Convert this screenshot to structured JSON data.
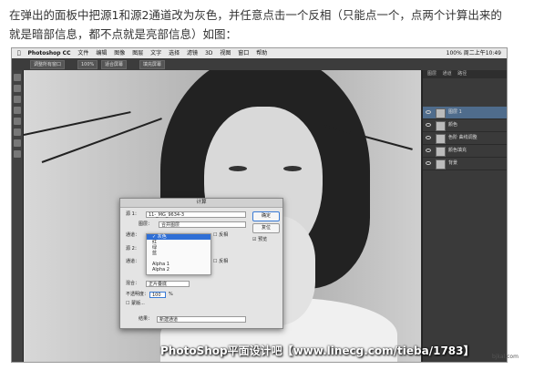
{
  "caption": "在弹出的面板中把源1和源2通道改为灰色，并任意点击一个反相（只能点一个，点两个计算出来的就是暗部信息，都不点就是亮部信息）如图：",
  "menubar": {
    "app": "Photoshop CC",
    "items": [
      "文件",
      "编辑",
      "图像",
      "图层",
      "文字",
      "选择",
      "滤镜",
      "3D",
      "视图",
      "窗口",
      "帮助"
    ],
    "status": "100% 周二上午10:49"
  },
  "options": {
    "chip1": "调整所有窗口",
    "chip2": "100%",
    "chip3": "适合屏幕",
    "chip4": "填充屏幕"
  },
  "dialog": {
    "title": "计算",
    "source1_label": "源 1：",
    "source1_value": "11-_MG_9634-3",
    "layer_label": "图层：",
    "layer_value": "合并图层",
    "channel_label": "通道：",
    "invert_label": "反相",
    "source2_label": "源 2：",
    "blend_label": "混合：",
    "blend_value": "正片叠底",
    "opacity_label": "不透明度：",
    "opacity_value": "100",
    "opacity_unit": "%",
    "mask_label": "蒙版...",
    "result_label": "结果：",
    "result_value": "新建通道",
    "ok": "确定",
    "reset": "复位",
    "preview": "预览",
    "dropdown": [
      "灰色",
      "红",
      "绿",
      "蓝",
      "Alpha 1",
      "Alpha 2"
    ]
  },
  "panel": {
    "tabs": [
      "图层",
      "通道",
      "路径"
    ],
    "layers": [
      "图层 1",
      "颜色",
      "色阶 曲线调整",
      "颜色填充",
      "背景"
    ]
  },
  "watermark": "PhotoShop平面设计吧【www.linecg.com/tieba/1783】",
  "corner": "bjkal.com"
}
